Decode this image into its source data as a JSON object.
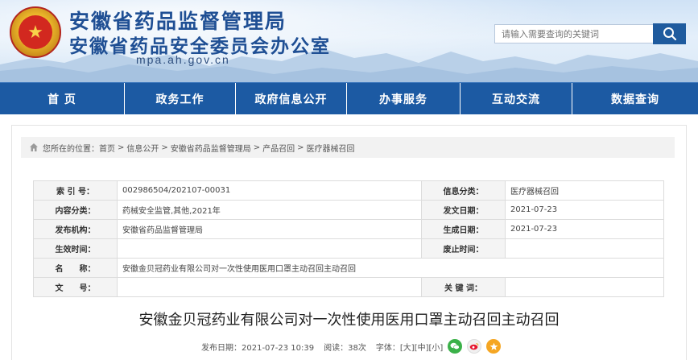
{
  "header": {
    "title_main": "安徽省药品监督管理局",
    "title_sub": "安徽省药品安全委员会办公室",
    "domain": "mpa.ah.gov.cn",
    "search_placeholder": "请输入需要查询的关键词"
  },
  "nav": [
    {
      "label": "首 页"
    },
    {
      "label": "政务工作"
    },
    {
      "label": "政府信息公开"
    },
    {
      "label": "办事服务"
    },
    {
      "label": "互动交流"
    },
    {
      "label": "数据查询"
    }
  ],
  "breadcrumb": {
    "prefix": "您所在的位置：",
    "items": [
      "首页",
      "信息公开",
      "安徽省药品监督管理局",
      "产品召回",
      "医疗器械召回"
    ]
  },
  "info_table": {
    "index_label": "索 引 号：",
    "index_value": "002986504/202107-00031",
    "info_cat_label": "信息分类：",
    "info_cat_value": "医疗器械召回",
    "content_cat_label": "内容分类：",
    "content_cat_value": "药械安全监管,其他,2021年",
    "pub_date_label": "发文日期：",
    "pub_date_value": "2021-07-23",
    "publisher_label": "发布机构：",
    "publisher_value": "安徽省药品监督管理局",
    "gen_date_label": "生成日期：",
    "gen_date_value": "2021-07-23",
    "effective_label": "生效时间：",
    "effective_value": "",
    "abolish_label": "废止时间：",
    "abolish_value": "",
    "name_label": "名　　称：",
    "name_value": "安徽金贝冠药业有限公司对一次性使用医用口罩主动召回主动召回",
    "doc_no_label": "文　　号：",
    "doc_no_value": "",
    "keywords_label": "关 键 词：",
    "keywords_value": ""
  },
  "article": {
    "title": "安徽金贝冠药业有限公司对一次性使用医用口罩主动召回主动召回",
    "publish_time": "发布日期：2021-07-23 10:39",
    "views": "阅读：38次",
    "font_label": "字体：",
    "font_large": "[大]",
    "font_medium": "[中]",
    "font_small": "[小]"
  },
  "colors": {
    "nav_bg": "#1c5aa3",
    "title_blue": "#1f4f94",
    "search_btn": "#1f5b9e"
  }
}
